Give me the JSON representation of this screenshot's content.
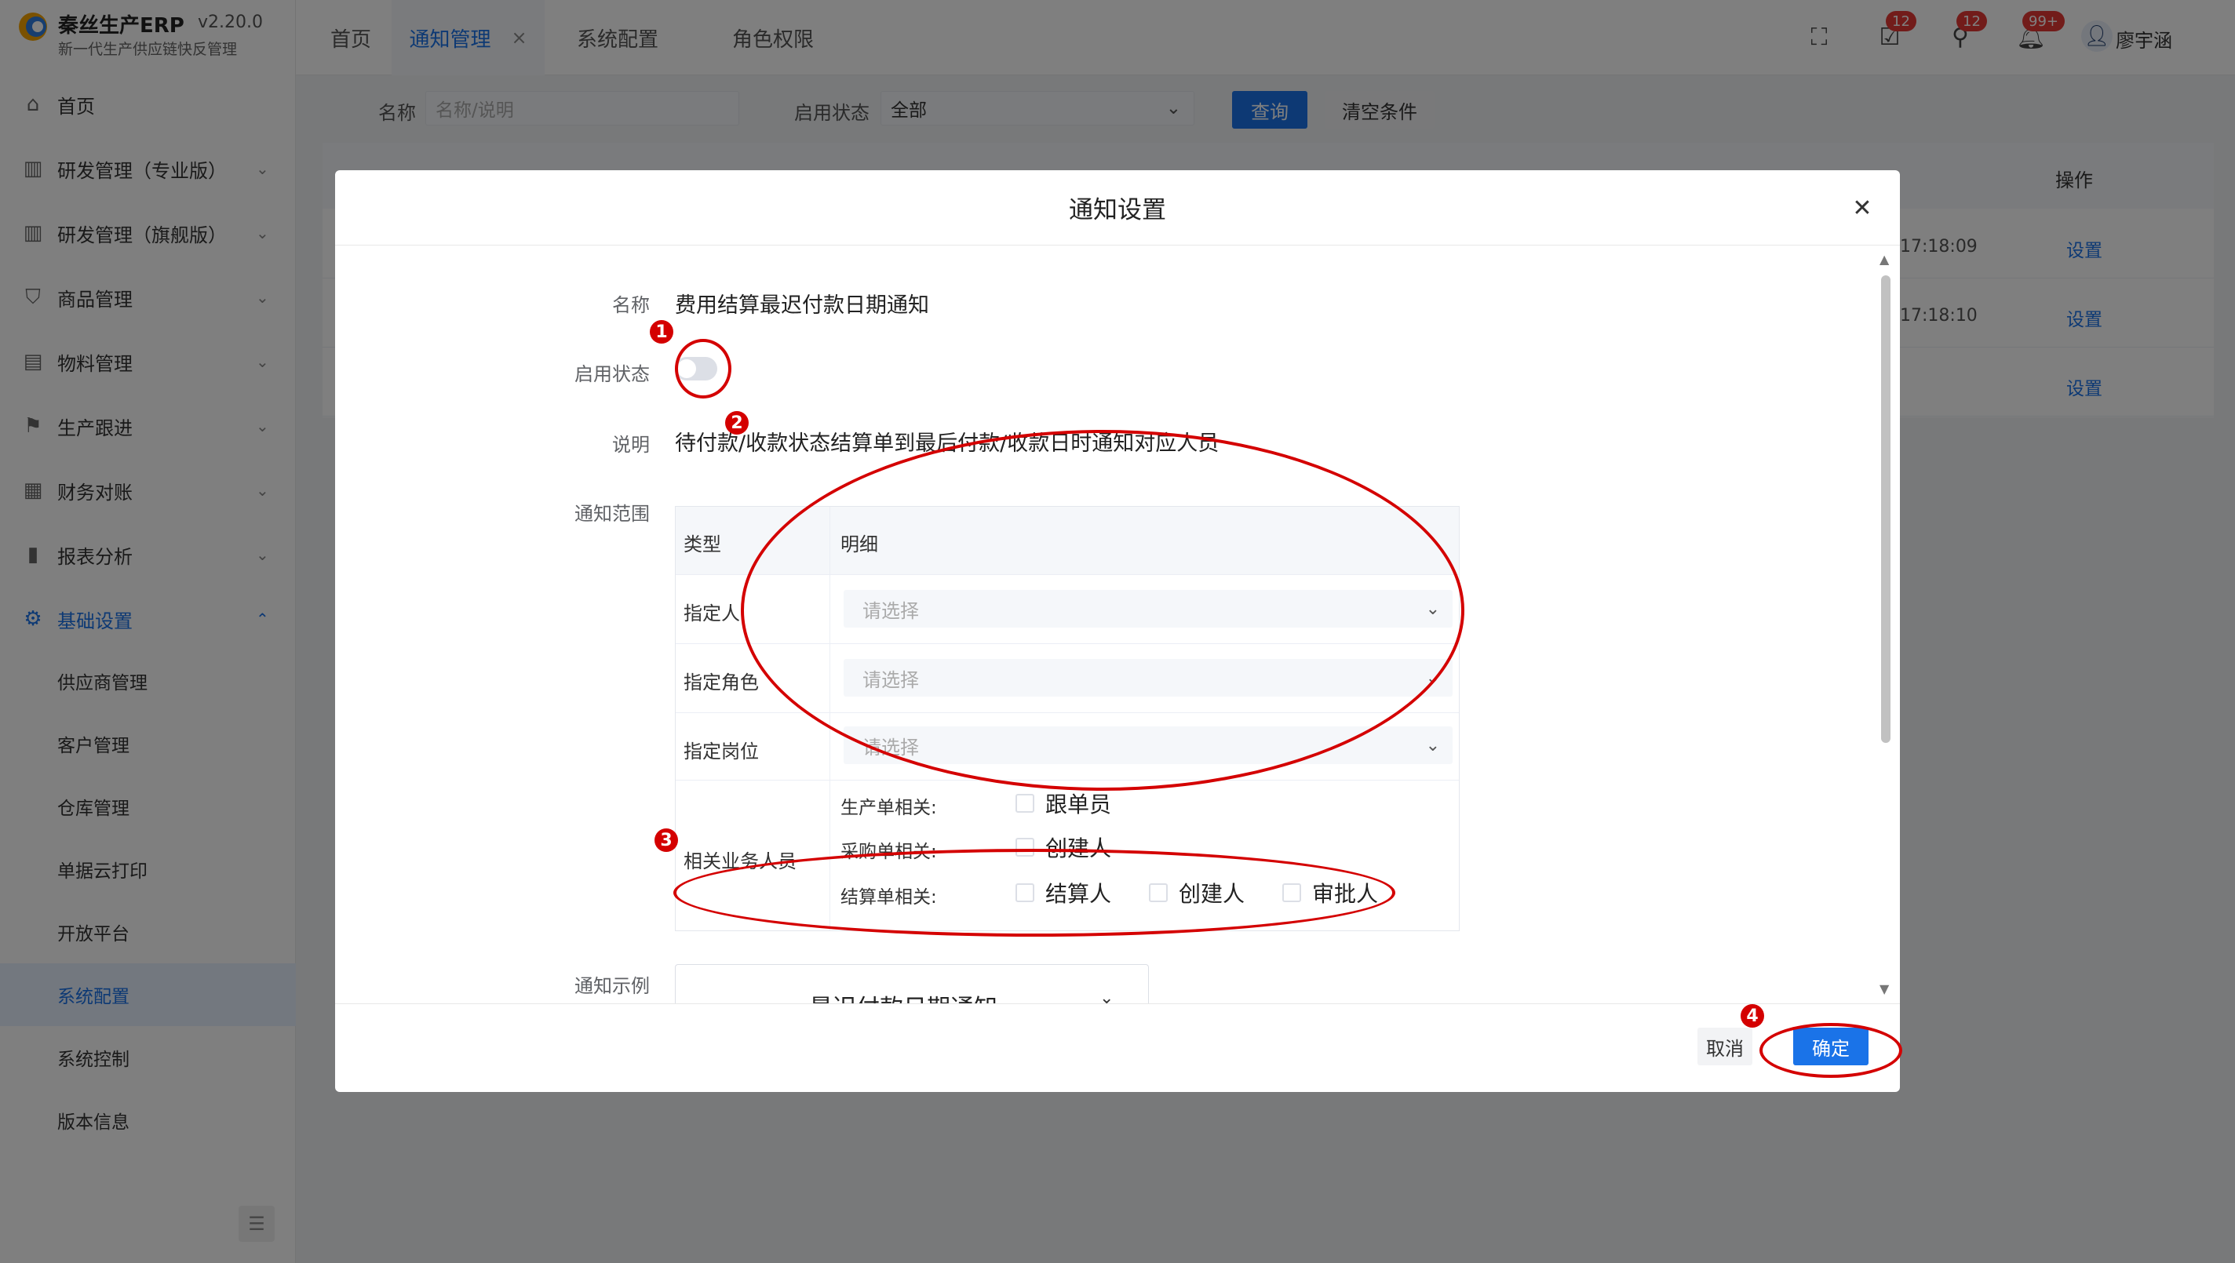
{
  "app": {
    "name": "秦丝生产ERP",
    "version": "v2.20.0",
    "subtitle": "新一代生产供应链快反管理"
  },
  "sidebar": {
    "items": [
      {
        "label": "首页",
        "icon": "home-icon"
      },
      {
        "label": "研发管理（专业版）",
        "icon": "book-icon"
      },
      {
        "label": "研发管理（旗舰版）",
        "icon": "book-icon"
      },
      {
        "label": "商品管理",
        "icon": "shirt-icon"
      },
      {
        "label": "物料管理",
        "icon": "document-icon"
      },
      {
        "label": "生产跟进",
        "icon": "flag-icon"
      },
      {
        "label": "财务对账",
        "icon": "grid-icon"
      },
      {
        "label": "报表分析",
        "icon": "bar-chart-icon"
      },
      {
        "label": "基础设置",
        "icon": "gear-icon"
      }
    ],
    "sub_items": [
      "供应商管理",
      "客户管理",
      "仓库管理",
      "单据云打印",
      "开放平台",
      "系统配置",
      "系统控制",
      "版本信息"
    ],
    "selected_sub": "系统配置"
  },
  "header": {
    "tabs": [
      "首页",
      "通知管理",
      "系统配置",
      "角色权限"
    ],
    "active_tab": "通知管理",
    "badges": [
      "12",
      "12",
      "99+"
    ],
    "user_name": "廖宇涵"
  },
  "filter": {
    "name_label": "名称",
    "name_placeholder": "名称/说明",
    "status_label": "启用状态",
    "status_value": "全部",
    "query_button": "查询",
    "clear_button": "清空条件"
  },
  "bg_table": {
    "op_header": "操作",
    "rows": [
      {
        "time": "17:18:09",
        "action": "设置"
      },
      {
        "time": "17:18:10",
        "action": "设置"
      },
      {
        "time": "",
        "action": "设置"
      }
    ]
  },
  "modal": {
    "title": "通知设置",
    "name_label": "名称",
    "name_value": "费用结算最迟付款日期通知",
    "status_label": "启用状态",
    "desc_label": "说明",
    "desc_value": "待付款/收款状态结算单到最后付款/收款日时通知对应人员",
    "scope_label": "通知范围",
    "table": {
      "col_type": "类型",
      "col_detail": "明细",
      "row1": "指定人",
      "row2": "指定角色",
      "row3": "指定岗位",
      "row4": "相关业务人员",
      "select_placeholder": "请选择",
      "groups": [
        {
          "label": "生产单相关:",
          "options": [
            "跟单员"
          ]
        },
        {
          "label": "采购单相关:",
          "options": [
            "创建人"
          ]
        },
        {
          "label": "结算单相关:",
          "options": [
            "结算人",
            "创建人",
            "审批人"
          ]
        }
      ]
    },
    "example_label": "通知示例",
    "example_title": "最迟付款日期通知",
    "cancel_button": "取消",
    "confirm_button": "确定"
  },
  "annotations": [
    "1",
    "2",
    "3",
    "4"
  ]
}
